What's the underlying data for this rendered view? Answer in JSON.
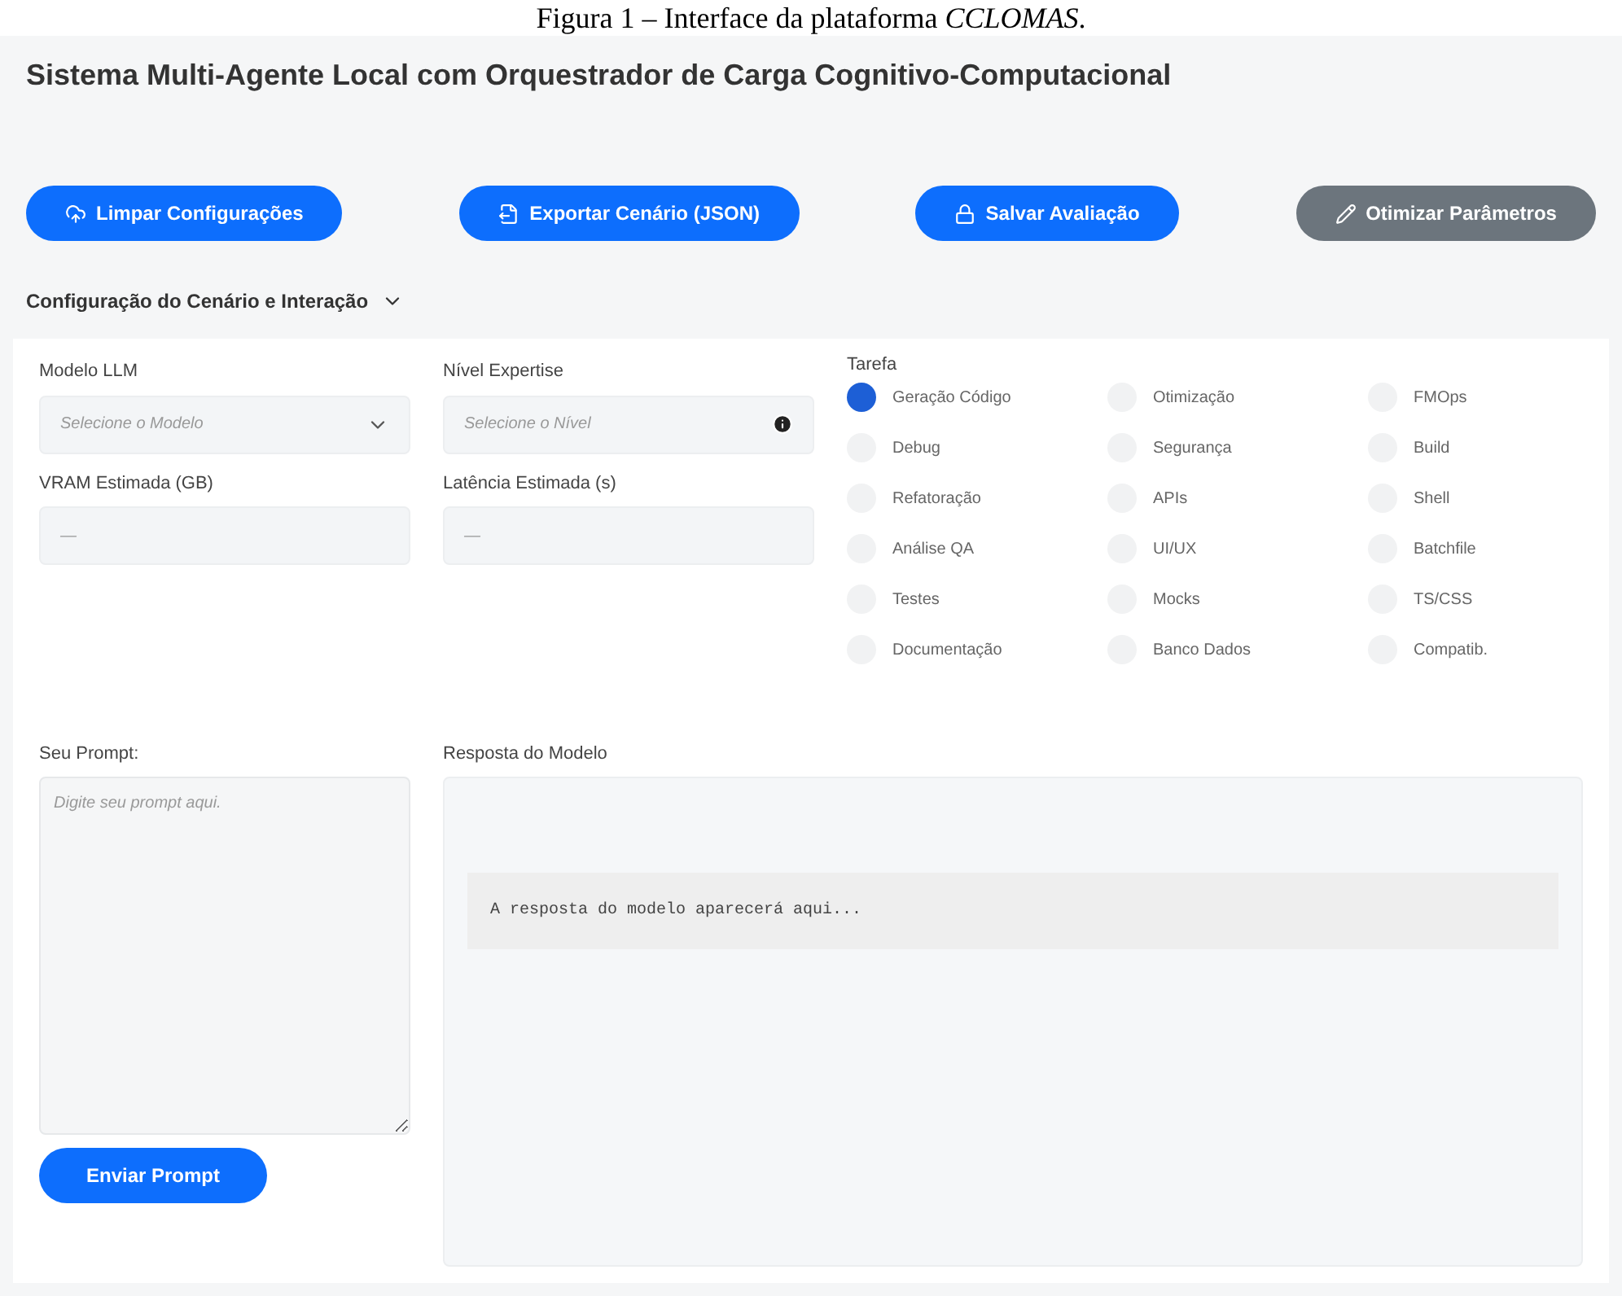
{
  "caption": "Figura 1 – Interface da plataforma *CCLOMAS*.",
  "title": "Sistema Multi-Agente Local com Orquestrador de Carga Cognitivo-Computacional",
  "toolbar": [
    {
      "label": "Limpar Configurações",
      "kind": "primary"
    },
    {
      "label": "Exportar Cenário (JSON)",
      "kind": "primary"
    },
    {
      "label": "Salvar Avaliação",
      "kind": "primary"
    },
    {
      "label": "Otimizar Parâmetros",
      "kind": "secondary"
    }
  ],
  "section": {
    "title": "Configuração do Cenário e Interação",
    "expanded": true
  },
  "fields": [
    {
      "label": "Modelo LLM",
      "kind": "select",
      "placeholder": "Selecione o Modelo"
    },
    {
      "label": "Nível Expertise",
      "kind": "info",
      "placeholder": "Selecione o Nível"
    },
    {
      "label": "VRAM Estimada (GB)",
      "kind": "readout",
      "placeholder": "—"
    },
    {
      "label": "Latência Estimada (s)",
      "kind": "readout",
      "placeholder": "—"
    }
  ],
  "task": {
    "label": "Tarefa",
    "options": [
      {
        "label": "Geração Código",
        "selected": true
      },
      {
        "label": "Otimização",
        "selected": false
      },
      {
        "label": "FMOps",
        "selected": false
      },
      {
        "label": "Debug",
        "selected": false
      },
      {
        "label": "Segurança",
        "selected": false
      },
      {
        "label": "Build",
        "selected": false
      },
      {
        "label": "Refatoração",
        "selected": false
      },
      {
        "label": "APIs",
        "selected": false
      },
      {
        "label": "Shell",
        "selected": false
      },
      {
        "label": "Análise QA",
        "selected": false
      },
      {
        "label": "UI/UX",
        "selected": false
      },
      {
        "label": "Batchfile",
        "selected": false
      },
      {
        "label": "Testes",
        "selected": false
      },
      {
        "label": "Mocks",
        "selected": false
      },
      {
        "label": "TS/CSS",
        "selected": false
      },
      {
        "label": "Documentação",
        "selected": false
      },
      {
        "label": "Banco Dados",
        "selected": false
      },
      {
        "label": "Compatib.",
        "selected": false
      }
    ]
  },
  "prompt": {
    "label": "Seu Prompt:",
    "placeholder": "Digite seu prompt aqui.",
    "button": "Enviar Prompt"
  },
  "response": {
    "label": "Resposta do Modelo",
    "text": "A resposta do modelo aparecerá aqui..."
  }
}
